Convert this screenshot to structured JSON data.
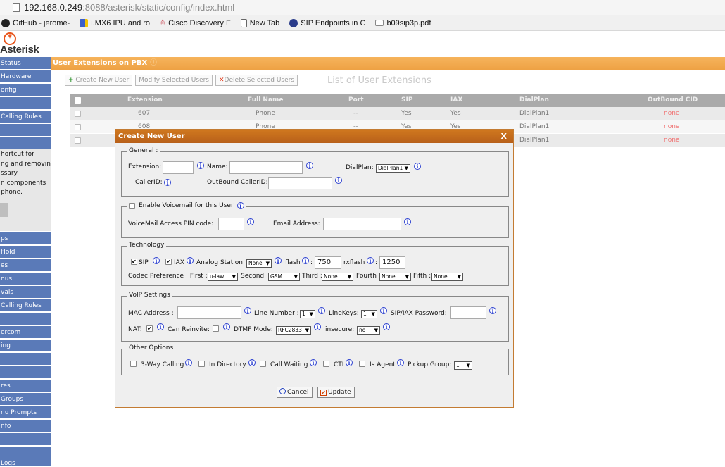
{
  "browser": {
    "url_host": "192.168.0.249",
    "url_rest": ":8088/asterisk/static/config/index.html",
    "bookmarks": [
      "GitHub - jerome-",
      "i.MX6 IPU and ro",
      "Cisco Discovery F",
      "New Tab",
      "SIP Endpoints in C",
      "b09sip3p.pdf"
    ]
  },
  "logo_text": "Asterisk",
  "sidebar": {
    "items_top": [
      "Status",
      "Hardware",
      "onfig",
      "",
      "Calling Rules",
      "",
      ""
    ],
    "info_lines": [
      "hortcut for",
      "ng and removing",
      "ssary",
      "n components",
      "phone."
    ],
    "items_bottom": [
      "ps",
      "Hold",
      "es",
      "nus",
      "vals",
      "Calling Rules",
      "",
      "ercom",
      "ing",
      "",
      "",
      "res",
      "Groups",
      "nu Prompts",
      "nfo",
      "",
      "",
      "Logs"
    ]
  },
  "panel": {
    "title": "User Extensions on PBX",
    "help_glyph": "ⓘ",
    "list_title": "List of User Extensions",
    "toolbar": {
      "create": "Create New User",
      "modify": "Modify Selected Users",
      "delete": "Delete Selected Users"
    }
  },
  "table": {
    "columns": [
      "Extension",
      "Full Name",
      "Port",
      "SIP",
      "IAX",
      "DialPlan",
      "OutBound CID"
    ],
    "rows": [
      {
        "ext": "607",
        "name": "Phone",
        "port": "--",
        "sip": "Yes",
        "iax": "Yes",
        "dialplan": "DialPlan1",
        "cid": "none"
      },
      {
        "ext": "608",
        "name": "Phone",
        "port": "--",
        "sip": "Yes",
        "iax": "Yes",
        "dialplan": "DialPlan1",
        "cid": "none"
      },
      {
        "ext": "",
        "name": "",
        "port": "",
        "sip": "",
        "iax": "",
        "dialplan": "DialPlan1",
        "cid": "none"
      }
    ]
  },
  "dialog": {
    "title": "Create New User",
    "close": "X",
    "general": {
      "legend": "General :",
      "extension_label": "Extension:",
      "extension_value": "",
      "name_label": "Name:",
      "name_value": "",
      "dialplan_label": "DialPlan:",
      "dialplan_value": "DialPlan1",
      "callerid_label": "CallerID:",
      "outbound_label": "OutBound CallerID:",
      "outbound_value": ""
    },
    "voicemail": {
      "legend": "Enable Voicemail for this User",
      "pin_label": "VoiceMail Access PIN code:",
      "pin_value": "",
      "email_label": "Email Address:",
      "email_value": ""
    },
    "technology": {
      "legend": "Technology",
      "sip_label": "SIP",
      "iax_label": "IAX",
      "analog_label": "Analog Station:",
      "analog_value": "None",
      "flash_label": "flash",
      "flash_value": "750",
      "rxflash_label": "rxflash",
      "rxflash_value": "1250",
      "codec_label": "Codec Preference : First :",
      "first_value": "u-law",
      "second_label": "Second :",
      "second_value": "GSM",
      "third_label": "Third :",
      "third_value": "None",
      "fourth_label": "Fourth :",
      "fourth_value": "None",
      "fifth_label": "Fifth :",
      "fifth_value": "None"
    },
    "voip": {
      "legend": "VoIP Settings",
      "mac_label": "MAC Address :",
      "mac_value": "",
      "line_label": "Line Number :",
      "line_value": "1",
      "linekeys_label": "LineKeys:",
      "linekeys_value": "1",
      "pw_label": "SIP/IAX Password:",
      "pw_value": "",
      "nat_label": "NAT:",
      "reinvite_label": "Can Reinvite:",
      "dtmf_label": "DTMF Mode:",
      "dtmf_value": "RFC2833",
      "insecure_label": "insecure:",
      "insecure_value": "no"
    },
    "other": {
      "legend": "Other Options",
      "three_way": "3-Way Calling",
      "in_directory": "In Directory",
      "call_waiting": "Call Waiting",
      "cti": "CTI",
      "is_agent": "Is Agent",
      "pickup_label": "Pickup Group:",
      "pickup_value": "1"
    },
    "buttons": {
      "cancel": "Cancel",
      "update": "Update"
    },
    "arrow": "▼",
    "check": "✔",
    "info_glyph": "i"
  }
}
